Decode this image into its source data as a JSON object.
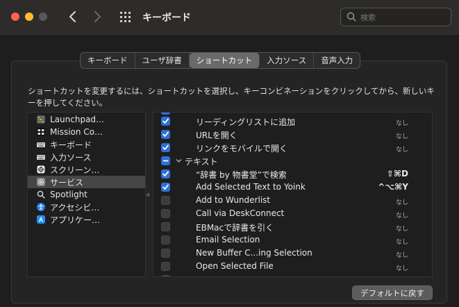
{
  "window": {
    "title": "キーボード"
  },
  "search": {
    "placeholder": "検索"
  },
  "tabs": [
    {
      "label": "キーボード",
      "active": false
    },
    {
      "label": "ユーザ辞書",
      "active": false
    },
    {
      "label": "ショートカット",
      "active": true
    },
    {
      "label": "入力ソース",
      "active": false
    },
    {
      "label": "音声入力",
      "active": false
    }
  ],
  "description": "ショートカットを変更するには、ショートカットを選択し、キーコンビネーションをクリックしてから、新しいキーを押してください。",
  "categories": [
    {
      "label": "Launchpad…",
      "icon": "launchpad-icon",
      "selected": false
    },
    {
      "label": "Mission Co…",
      "icon": "mission-control-icon",
      "selected": false
    },
    {
      "label": "キーボード",
      "icon": "keyboard-icon",
      "selected": false
    },
    {
      "label": "入力ソース",
      "icon": "input-source-icon",
      "selected": false
    },
    {
      "label": "スクリーン…",
      "icon": "screenshot-icon",
      "selected": false
    },
    {
      "label": "サービス",
      "icon": "gear-icon",
      "selected": true
    },
    {
      "label": "Spotlight",
      "icon": "spotlight-icon",
      "selected": false
    },
    {
      "label": "アクセシビ…",
      "icon": "accessibility-icon",
      "selected": false
    },
    {
      "label": "アプリケー…",
      "icon": "app-store-icon",
      "selected": false
    }
  ],
  "shortcuts": [
    {
      "label": "リーディングリストに追加",
      "state": "on",
      "shortcut": "なし",
      "group": false
    },
    {
      "label": "URLを開く",
      "state": "on",
      "shortcut": "なし",
      "group": false
    },
    {
      "label": "リンクをモバイルで開く",
      "state": "on",
      "shortcut": "なし",
      "group": false
    },
    {
      "label": "テキスト",
      "state": "mixed",
      "shortcut": "",
      "group": true
    },
    {
      "label": "“辞書 by 物書堂”で検索",
      "state": "on",
      "shortcut": "⇧⌘D",
      "group": false
    },
    {
      "label": "Add Selected Text to Yoink",
      "state": "on",
      "shortcut": "^⌥⌘Y",
      "group": false
    },
    {
      "label": "Add to Wunderlist",
      "state": "off",
      "shortcut": "なし",
      "group": false
    },
    {
      "label": "Call via DeskConnect",
      "state": "off",
      "shortcut": "なし",
      "group": false
    },
    {
      "label": "EBMacで辞書を引く",
      "state": "off",
      "shortcut": "なし",
      "group": false
    },
    {
      "label": "Email Selection",
      "state": "off",
      "shortcut": "なし",
      "group": false
    },
    {
      "label": "New Buffer C...ing Selection",
      "state": "off",
      "shortcut": "なし",
      "group": false
    },
    {
      "label": "Open Selected File",
      "state": "off",
      "shortcut": "なし",
      "group": false
    }
  ],
  "buttons": {
    "restore_defaults": "デフォルトに戻す"
  },
  "colors": {
    "accent": "#2f6fd8",
    "close": "#fe5f57",
    "minimize": "#febc2e"
  }
}
